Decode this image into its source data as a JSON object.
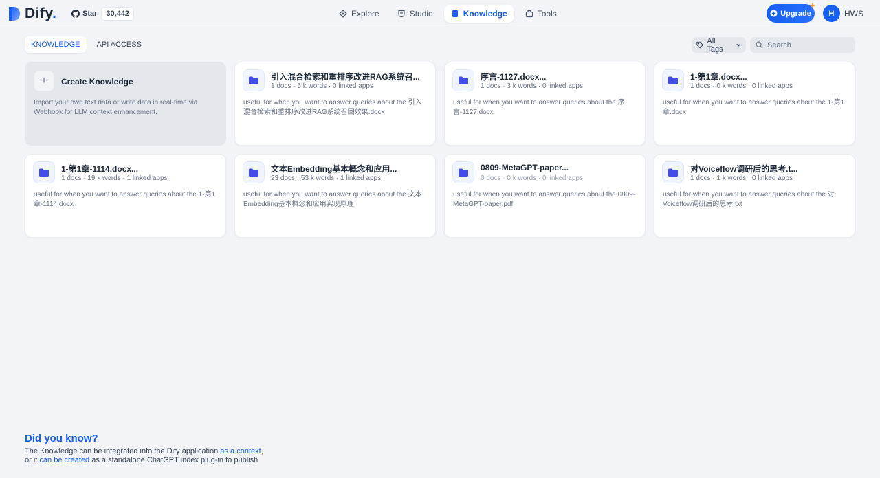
{
  "brand": {
    "name": "Dify",
    "dot": "."
  },
  "github": {
    "star_label": "Star",
    "count": "30,442"
  },
  "nav": [
    {
      "label": "Explore",
      "icon": "compass-icon"
    },
    {
      "label": "Studio",
      "icon": "studio-icon"
    },
    {
      "label": "Knowledge",
      "icon": "book-icon",
      "active": true
    },
    {
      "label": "Tools",
      "icon": "toolbox-icon"
    }
  ],
  "upgrade": {
    "label": "Upgrade"
  },
  "user": {
    "initial": "H",
    "name": "HWS"
  },
  "tabs": [
    {
      "label": "KNOWLEDGE",
      "active": true
    },
    {
      "label": "API ACCESS",
      "active": false
    }
  ],
  "tags_filter": {
    "label": "All Tags"
  },
  "search": {
    "placeholder": "Search"
  },
  "create_card": {
    "title": "Create Knowledge",
    "desc": "Import your own text data or write data in real-time via Webhook for LLM context enhancement."
  },
  "datasets": [
    {
      "title": "引入混合检索和重排序改进RAG系统召...",
      "meta": "1 docs · 5 k words · 0 linked apps",
      "desc": "useful for when you want to answer queries about the 引入混合检索和重排序改进RAG系统召回效果.docx"
    },
    {
      "title": "序言-1127.docx...",
      "meta": "1 docs · 3 k words · 0 linked apps",
      "desc": "useful for when you want to answer queries about the 序言-1127.docx"
    },
    {
      "title": "1-第1章.docx...",
      "meta": "1 docs · 0 k words · 0 linked apps",
      "desc": "useful for when you want to answer queries about the 1-第1章.docx"
    },
    {
      "title": "1-第1章-1114.docx...",
      "meta": "1 docs · 19 k words · 1 linked apps",
      "desc": "useful for when you want to answer queries about the 1-第1章-1114.docx"
    },
    {
      "title": "文本Embedding基本概念和应用...",
      "meta": "23 docs · 53 k words · 1 linked apps",
      "desc": "useful for when you want to answer queries about the 文本Embedding基本概念和应用实现原理"
    },
    {
      "title": "0809-MetaGPT-paper...",
      "meta": "0 docs · 0 k words · 0 linked apps",
      "desc": "useful for when you want to answer queries about the 0809-MetaGPT-paper.pdf",
      "muted": true
    },
    {
      "title": "对Voiceflow调研后的思考.t...",
      "meta": "1 docs · 1 k words · 0 linked apps",
      "desc": "useful for when you want to answer queries about the 对Voiceflow调研后的思考.txt"
    }
  ],
  "did_you_know": {
    "title": "Did you know?",
    "line1_pre": "The Knowledge can be integrated into the Dify application ",
    "line1_link": "as a context",
    "line1_post": ",",
    "line2_pre": "or it ",
    "line2_link": "can be created",
    "line2_post": " as a standalone ChatGPT index plug-in to publish"
  },
  "colors": {
    "accent": "#155eef",
    "folder": "#444ce7",
    "background": "#f2f4f7"
  }
}
